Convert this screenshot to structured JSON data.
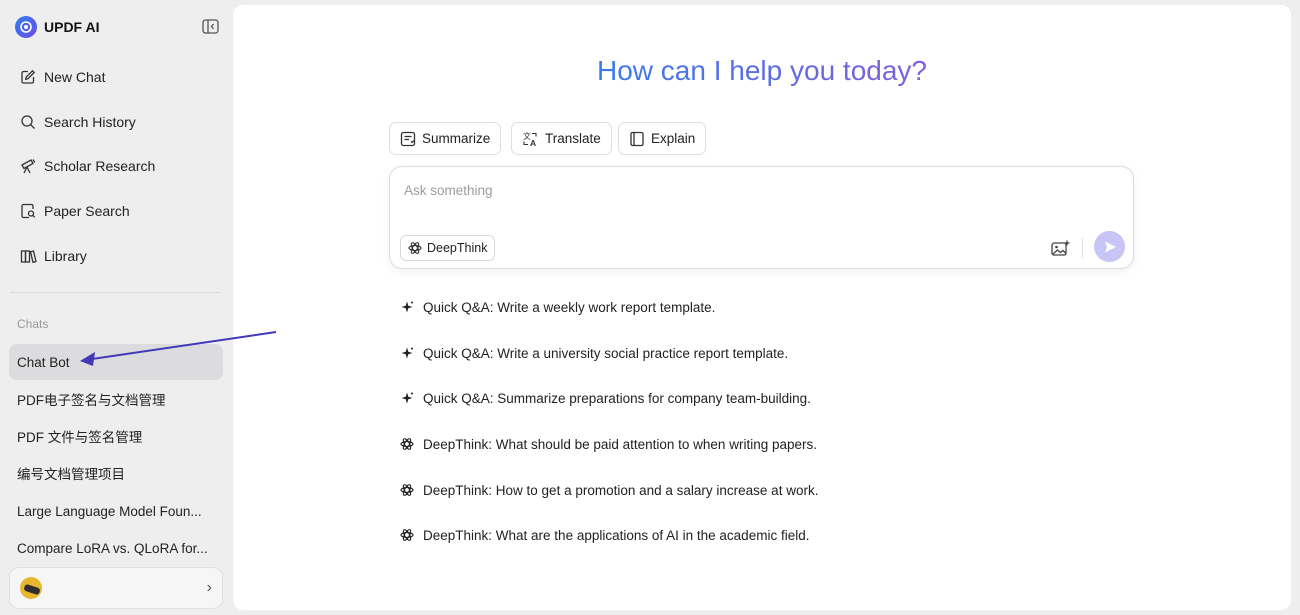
{
  "app": {
    "name": "UPDF AI"
  },
  "sidebar": {
    "nav": [
      {
        "label": "New Chat",
        "icon": "edit-icon"
      },
      {
        "label": "Search History",
        "icon": "search-icon"
      },
      {
        "label": "Scholar Research",
        "icon": "telescope-icon"
      },
      {
        "label": "Paper Search",
        "icon": "document-search-icon"
      },
      {
        "label": "Library",
        "icon": "library-icon"
      }
    ],
    "chats_label": "Chats",
    "chats": [
      {
        "label": "Chat Bot",
        "active": true
      },
      {
        "label": "PDF电子签名与文档管理"
      },
      {
        "label": "PDF 文件与签名管理"
      },
      {
        "label": "编号文档管理项目"
      },
      {
        "label": "Large Language Model Foun..."
      },
      {
        "label": "Compare LoRA vs. QLoRA for..."
      }
    ]
  },
  "main": {
    "headline": "How can I help you today?",
    "quick_actions": [
      {
        "label": "Summarize",
        "icon": "summarize-icon"
      },
      {
        "label": "Translate",
        "icon": "translate-icon"
      },
      {
        "label": "Explain",
        "icon": "book-icon"
      }
    ],
    "prompt": {
      "placeholder": "Ask something",
      "deepthink_label": "DeepThink"
    },
    "suggestions": [
      {
        "icon": "sparkle-icon",
        "text": "Quick Q&A: Write a weekly work report template."
      },
      {
        "icon": "sparkle-icon",
        "text": "Quick Q&A: Write a university social practice report template."
      },
      {
        "icon": "sparkle-icon",
        "text": "Quick Q&A: Summarize preparations for company team-building."
      },
      {
        "icon": "atom-icon",
        "text": "DeepThink: What should be paid attention to when writing papers."
      },
      {
        "icon": "atom-icon",
        "text": "DeepThink: How to get a promotion and a salary increase at work."
      },
      {
        "icon": "atom-icon",
        "text": "DeepThink: What are the applications of AI in the academic field."
      }
    ]
  },
  "colors": {
    "accent": "#2f7df0",
    "accent2": "#8a5cd8",
    "send_button": "#c9c4f6",
    "active_chat": "#dcdcdf",
    "annotation_arrow": "#4338b8"
  }
}
